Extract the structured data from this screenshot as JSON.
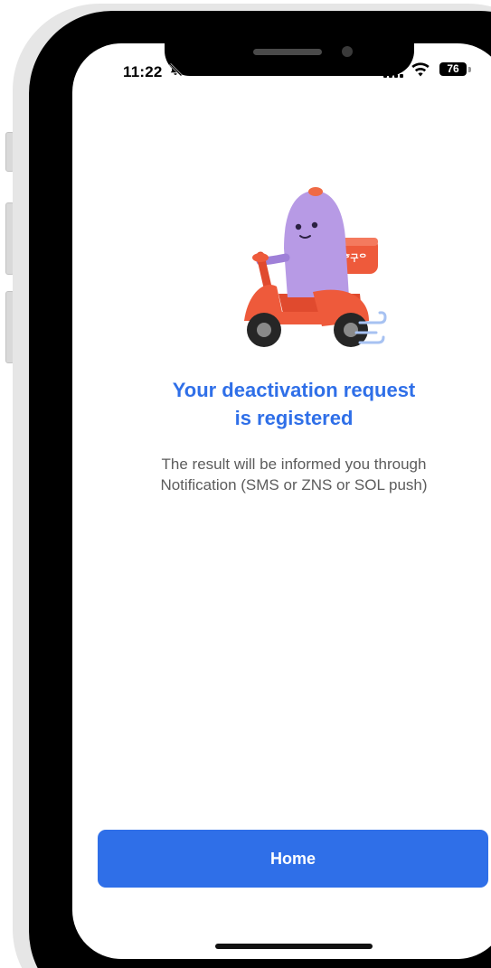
{
  "status_bar": {
    "time": "11:22",
    "battery_level": "76",
    "icons": [
      "bell-slash-icon",
      "cellular-signal-icon",
      "wifi-icon",
      "battery-icon"
    ]
  },
  "illustration": {
    "icon": "delivery-scooter-icon",
    "box_label": "ᄒ구ᄋ"
  },
  "content": {
    "title_line1": "Your deactivation request",
    "title_line2": "is registered",
    "description_line1": "The result will be informed you through",
    "description_line2": "Notification (SMS or ZNS or SOL push)"
  },
  "actions": {
    "home_label": "Home"
  },
  "colors": {
    "accent": "#2f6fe8",
    "text_secondary": "#5c5c5c",
    "frame": "#000000",
    "scooter": "#ee5a3b",
    "character": "#b79ae5"
  }
}
